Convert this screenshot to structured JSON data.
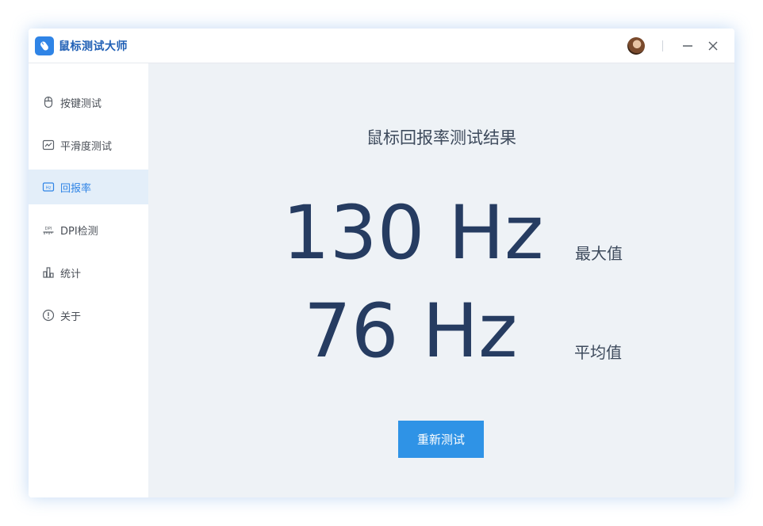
{
  "app": {
    "title": "鼠标测试大师",
    "icon": "mouse-icon",
    "accent_color": "#2f84e6"
  },
  "titlebar": {
    "avatar": "user-avatar",
    "minimize_icon": "minimize-icon",
    "close_icon": "close-icon"
  },
  "sidebar": {
    "items": [
      {
        "label": "按键测试",
        "icon": "mouse-icon",
        "active": false
      },
      {
        "label": "平滑度测试",
        "icon": "line-chart-icon",
        "active": false
      },
      {
        "label": "回报率",
        "icon": "hz-icon",
        "active": true
      },
      {
        "label": "DPI检测",
        "icon": "dpi-icon",
        "active": false
      },
      {
        "label": "统计",
        "icon": "bar-chart-icon",
        "active": false
      },
      {
        "label": "关于",
        "icon": "info-icon",
        "active": false
      }
    ]
  },
  "result": {
    "title": "鼠标回报率测试结果",
    "max_value": "130 Hz",
    "max_label": "最大值",
    "avg_value": "76 Hz",
    "avg_label": "平均值",
    "retest_label": "重新测试"
  }
}
